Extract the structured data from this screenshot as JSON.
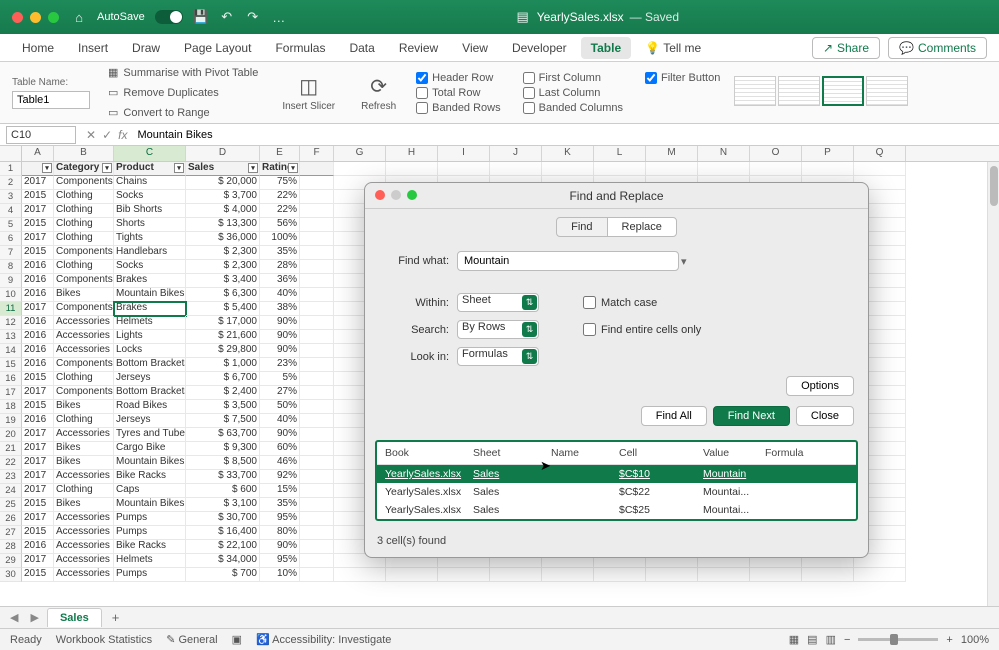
{
  "titlebar": {
    "autosave_label": "AutoSave",
    "doc_title": "YearlySales.xlsx",
    "saved_label": "— Saved"
  },
  "tabs": [
    "Home",
    "Insert",
    "Draw",
    "Page Layout",
    "Formulas",
    "Data",
    "Review",
    "View",
    "Developer",
    "Table",
    "Tell me"
  ],
  "active_tab": "Table",
  "share_label": "Share",
  "comments_label": "Comments",
  "ribbon": {
    "tablename_label": "Table Name:",
    "tablename_value": "Table1",
    "pivot": "Summarise with Pivot Table",
    "dupes": "Remove Duplicates",
    "range": "Convert to Range",
    "slicer": "Insert Slicer",
    "refresh": "Refresh",
    "opts": {
      "header_row": "Header Row",
      "total_row": "Total Row",
      "banded_rows": "Banded Rows",
      "first_col": "First Column",
      "last_col": "Last Column",
      "banded_cols": "Banded Columns",
      "filter_btn": "Filter Button"
    }
  },
  "namebox": "C10",
  "formula": "Mountain Bikes",
  "columns": [
    "A",
    "B",
    "C",
    "D",
    "E",
    "F",
    "G",
    "H",
    "I",
    "J",
    "K",
    "L",
    "M",
    "N",
    "O",
    "P",
    "Q"
  ],
  "headers": [
    "",
    "Category",
    "Product",
    "Sales",
    "Rating"
  ],
  "rows": [
    [
      "2017",
      "Components",
      "Chains",
      "$ 20,000",
      "75%"
    ],
    [
      "2015",
      "Clothing",
      "Socks",
      "$  3,700",
      "22%"
    ],
    [
      "2017",
      "Clothing",
      "Bib Shorts",
      "$  4,000",
      "22%"
    ],
    [
      "2015",
      "Clothing",
      "Shorts",
      "$ 13,300",
      "56%"
    ],
    [
      "2017",
      "Clothing",
      "Tights",
      "$ 36,000",
      "100%"
    ],
    [
      "2015",
      "Components",
      "Handlebars",
      "$  2,300",
      "35%"
    ],
    [
      "2016",
      "Clothing",
      "Socks",
      "$  2,300",
      "28%"
    ],
    [
      "2016",
      "Components",
      "Brakes",
      "$  3,400",
      "36%"
    ],
    [
      "2016",
      "Bikes",
      "Mountain Bikes",
      "$  6,300",
      "40%"
    ],
    [
      "2017",
      "Components",
      "Brakes",
      "$  5,400",
      "38%"
    ],
    [
      "2016",
      "Accessories",
      "Helmets",
      "$ 17,000",
      "90%"
    ],
    [
      "2016",
      "Accessories",
      "Lights",
      "$ 21,600",
      "90%"
    ],
    [
      "2016",
      "Accessories",
      "Locks",
      "$ 29,800",
      "90%"
    ],
    [
      "2016",
      "Components",
      "Bottom Brackets",
      "$  1,000",
      "23%"
    ],
    [
      "2015",
      "Clothing",
      "Jerseys",
      "$  6,700",
      "5%"
    ],
    [
      "2017",
      "Components",
      "Bottom Brackets",
      "$  2,400",
      "27%"
    ],
    [
      "2015",
      "Bikes",
      "Road Bikes",
      "$  3,500",
      "50%"
    ],
    [
      "2016",
      "Clothing",
      "Jerseys",
      "$  7,500",
      "40%"
    ],
    [
      "2017",
      "Accessories",
      "Tyres and Tubes",
      "$ 63,700",
      "90%"
    ],
    [
      "2017",
      "Bikes",
      "Cargo Bike",
      "$  9,300",
      "60%"
    ],
    [
      "2017",
      "Bikes",
      "Mountain Bikes",
      "$  8,500",
      "46%"
    ],
    [
      "2017",
      "Accessories",
      "Bike Racks",
      "$ 33,700",
      "92%"
    ],
    [
      "2017",
      "Clothing",
      "Caps",
      "$    600",
      "15%"
    ],
    [
      "2015",
      "Bikes",
      "Mountain Bikes",
      "$  3,100",
      "35%"
    ],
    [
      "2017",
      "Accessories",
      "Pumps",
      "$ 30,700",
      "95%"
    ],
    [
      "2015",
      "Accessories",
      "Pumps",
      "$ 16,400",
      "80%"
    ],
    [
      "2016",
      "Accessories",
      "Bike Racks",
      "$ 22,100",
      "90%"
    ],
    [
      "2017",
      "Accessories",
      "Helmets",
      "$ 34,000",
      "95%"
    ],
    [
      "2015",
      "Accessories",
      "Pumps",
      "$    700",
      "10%"
    ]
  ],
  "selected_row": 9,
  "dialog": {
    "title": "Find and Replace",
    "tab_find": "Find",
    "tab_replace": "Replace",
    "find_what_label": "Find what:",
    "find_what_value": "Mountain",
    "within_label": "Within:",
    "within_value": "Sheet",
    "search_label": "Search:",
    "search_value": "By Rows",
    "lookin_label": "Look in:",
    "lookin_value": "Formulas",
    "match_case": "Match case",
    "entire_cells": "Find entire cells only",
    "options_btn": "Options",
    "find_all": "Find All",
    "find_next": "Find Next",
    "close": "Close",
    "cols": [
      "Book",
      "Sheet",
      "Name",
      "Cell",
      "Value",
      "Formula"
    ],
    "results": [
      {
        "book": "YearlySales.xlsx",
        "sheet": "Sales",
        "name": "",
        "cell": "$C$10",
        "value": "Mountain",
        "formula": ""
      },
      {
        "book": "YearlySales.xlsx",
        "sheet": "Sales",
        "name": "",
        "cell": "$C$22",
        "value": "Mountai...",
        "formula": ""
      },
      {
        "book": "YearlySales.xlsx",
        "sheet": "Sales",
        "name": "",
        "cell": "$C$25",
        "value": "Mountai...",
        "formula": ""
      }
    ],
    "footer": "3 cell(s) found"
  },
  "sheet_tab": "Sales",
  "status": {
    "ready": "Ready",
    "wb_stats": "Workbook Statistics",
    "general": "General",
    "accessibility": "Accessibility: Investigate",
    "zoom": "100%"
  }
}
